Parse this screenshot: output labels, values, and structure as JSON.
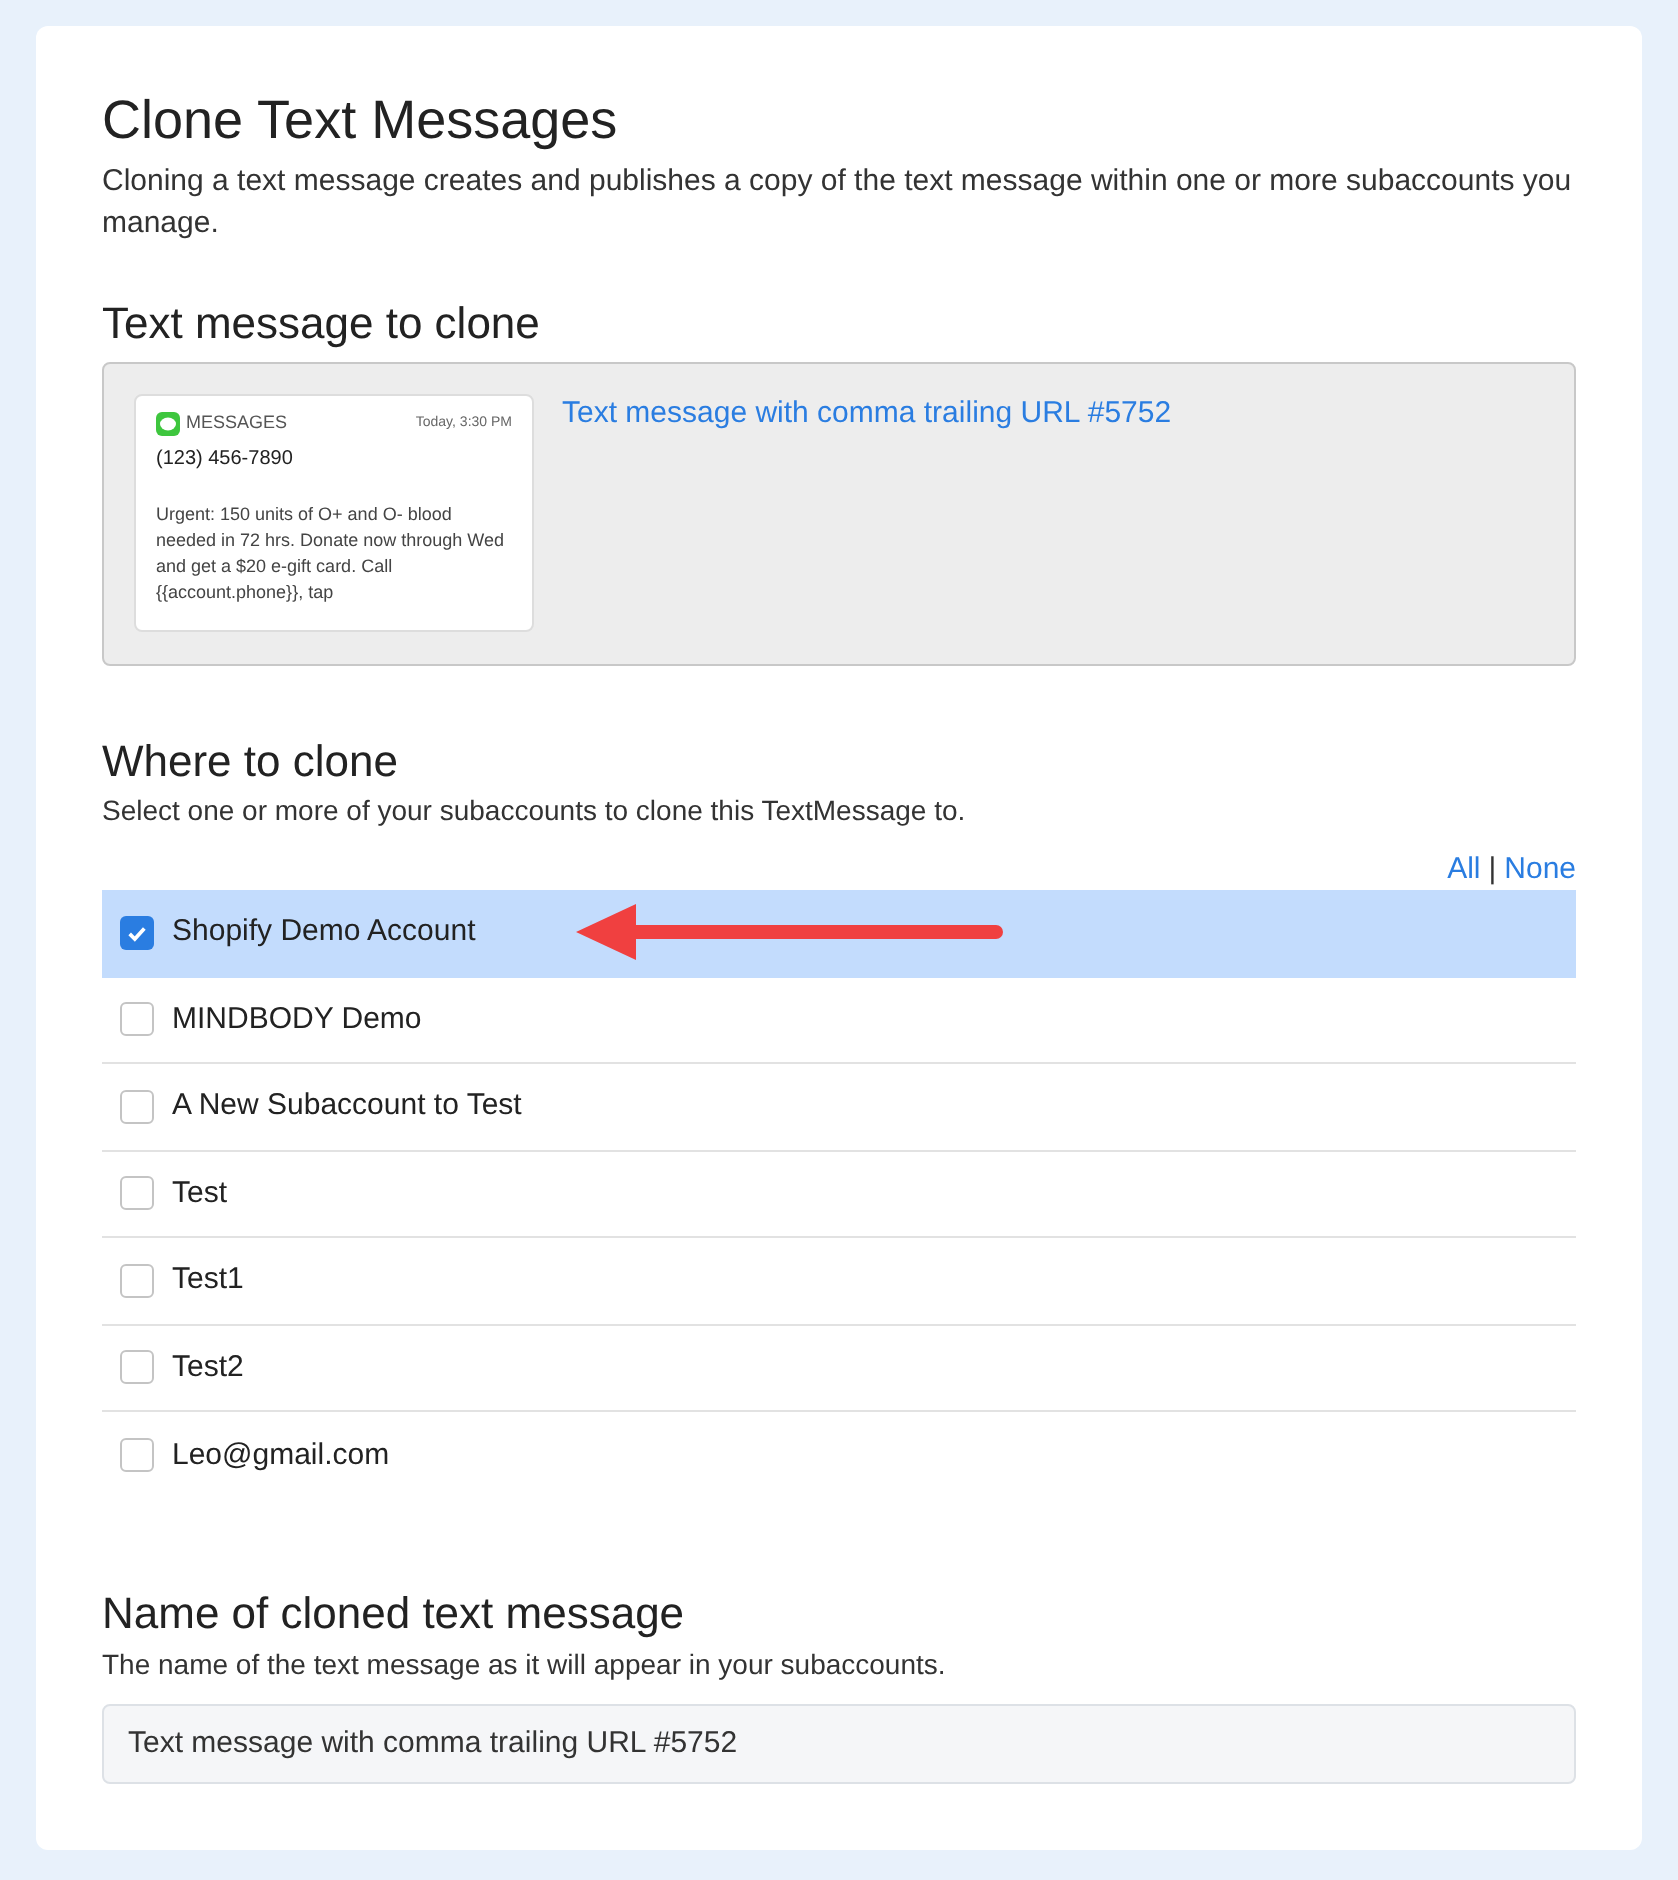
{
  "header": {
    "title": "Clone Text Messages",
    "description": "Cloning a text message creates and publishes a copy of the text message within one or more subaccounts you manage."
  },
  "source": {
    "heading": "Text message to clone",
    "preview": {
      "app": "MESSAGES",
      "time": "Today, 3:30 PM",
      "sender": "(123) 456-7890",
      "body": "Urgent: 150 units of O+ and O- blood needed in 72 hrs. Donate now through Wed and get a $20 e-gift card. Call {{account.phone}}, tap"
    },
    "link": "Text message with comma trailing URL #5752"
  },
  "target": {
    "heading": "Where to clone",
    "description": "Select one or more of your subaccounts to clone this TextMessage to.",
    "select_all": "All",
    "separator": "|",
    "select_none": "None",
    "accounts": [
      {
        "name": "Shopify Demo Account",
        "checked": true,
        "arrow": true
      },
      {
        "name": "MINDBODY Demo",
        "checked": false,
        "arrow": false
      },
      {
        "name": "A New Subaccount to Test",
        "checked": false,
        "arrow": false
      },
      {
        "name": "Test",
        "checked": false,
        "arrow": false
      },
      {
        "name": "Test1",
        "checked": false,
        "arrow": false
      },
      {
        "name": "Test2",
        "checked": false,
        "arrow": false
      },
      {
        "name": "Leo@gmail.com",
        "checked": false,
        "arrow": false
      }
    ]
  },
  "name_section": {
    "heading": "Name of cloned text message",
    "description": "The name of the text message as it will appear in your subaccounts.",
    "value": "Text message with comma trailing URL #5752"
  }
}
